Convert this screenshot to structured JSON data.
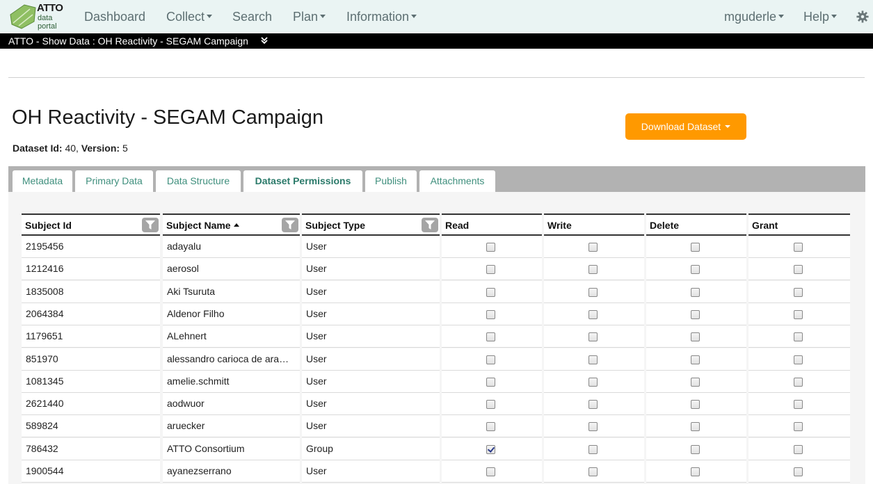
{
  "logo": {
    "brand": "ATTO",
    "line1": "data",
    "line2": "portal"
  },
  "nav": {
    "left": [
      {
        "label": "Dashboard",
        "dropdown": false
      },
      {
        "label": "Collect",
        "dropdown": true
      },
      {
        "label": "Search",
        "dropdown": false
      },
      {
        "label": "Plan",
        "dropdown": true
      },
      {
        "label": "Information",
        "dropdown": true
      }
    ],
    "user": "mguderle",
    "help": "Help",
    "settings_icon": "gear-icon"
  },
  "breadcrumb": "ATTO - Show Data : OH Reactivity - SEGAM Campaign",
  "page": {
    "title": "OH Reactivity - SEGAM Campaign",
    "dataset_id_label": "Dataset Id:",
    "dataset_id": "40",
    "version_label": "Version:",
    "version": "5",
    "download_label": "Download Dataset"
  },
  "tabs": [
    {
      "label": "Metadata",
      "active": false
    },
    {
      "label": "Primary Data",
      "active": false
    },
    {
      "label": "Data Structure",
      "active": false
    },
    {
      "label": "Dataset Permissions",
      "active": true
    },
    {
      "label": "Publish",
      "active": false
    },
    {
      "label": "Attachments",
      "active": false
    }
  ],
  "columns": [
    "Subject Id",
    "Subject Name",
    "Subject Type",
    "Read",
    "Write",
    "Delete",
    "Grant"
  ],
  "sorted_column": "Subject Name",
  "sort_direction": "ascending",
  "rows": [
    {
      "id": "2195456",
      "name": "adayalu",
      "type": "User",
      "read": false,
      "write": false,
      "delete": false,
      "grant": false
    },
    {
      "id": "1212416",
      "name": "aerosol",
      "type": "User",
      "read": false,
      "write": false,
      "delete": false,
      "grant": false
    },
    {
      "id": "1835008",
      "name": "Aki Tsuruta",
      "type": "User",
      "read": false,
      "write": false,
      "delete": false,
      "grant": false
    },
    {
      "id": "2064384",
      "name": "Aldenor Filho",
      "type": "User",
      "read": false,
      "write": false,
      "delete": false,
      "grant": false
    },
    {
      "id": "1179651",
      "name": "ALehnert",
      "type": "User",
      "read": false,
      "write": false,
      "delete": false,
      "grant": false
    },
    {
      "id": "851970",
      "name": "alessandro carioca de ara…",
      "type": "User",
      "read": false,
      "write": false,
      "delete": false,
      "grant": false
    },
    {
      "id": "1081345",
      "name": "amelie.schmitt",
      "type": "User",
      "read": false,
      "write": false,
      "delete": false,
      "grant": false
    },
    {
      "id": "2621440",
      "name": "aodwuor",
      "type": "User",
      "read": false,
      "write": false,
      "delete": false,
      "grant": false
    },
    {
      "id": "589824",
      "name": "aruecker",
      "type": "User",
      "read": false,
      "write": false,
      "delete": false,
      "grant": false
    },
    {
      "id": "786432",
      "name": "ATTO Consortium",
      "type": "Group",
      "read": true,
      "write": false,
      "delete": false,
      "grant": false
    },
    {
      "id": "1900544",
      "name": "ayanezserrano",
      "type": "User",
      "read": false,
      "write": false,
      "delete": false,
      "grant": false
    }
  ],
  "colors": {
    "accent": "#ff9900",
    "tab_text": "#3f8f7d",
    "navbar_bg": "#eaf4f3"
  }
}
